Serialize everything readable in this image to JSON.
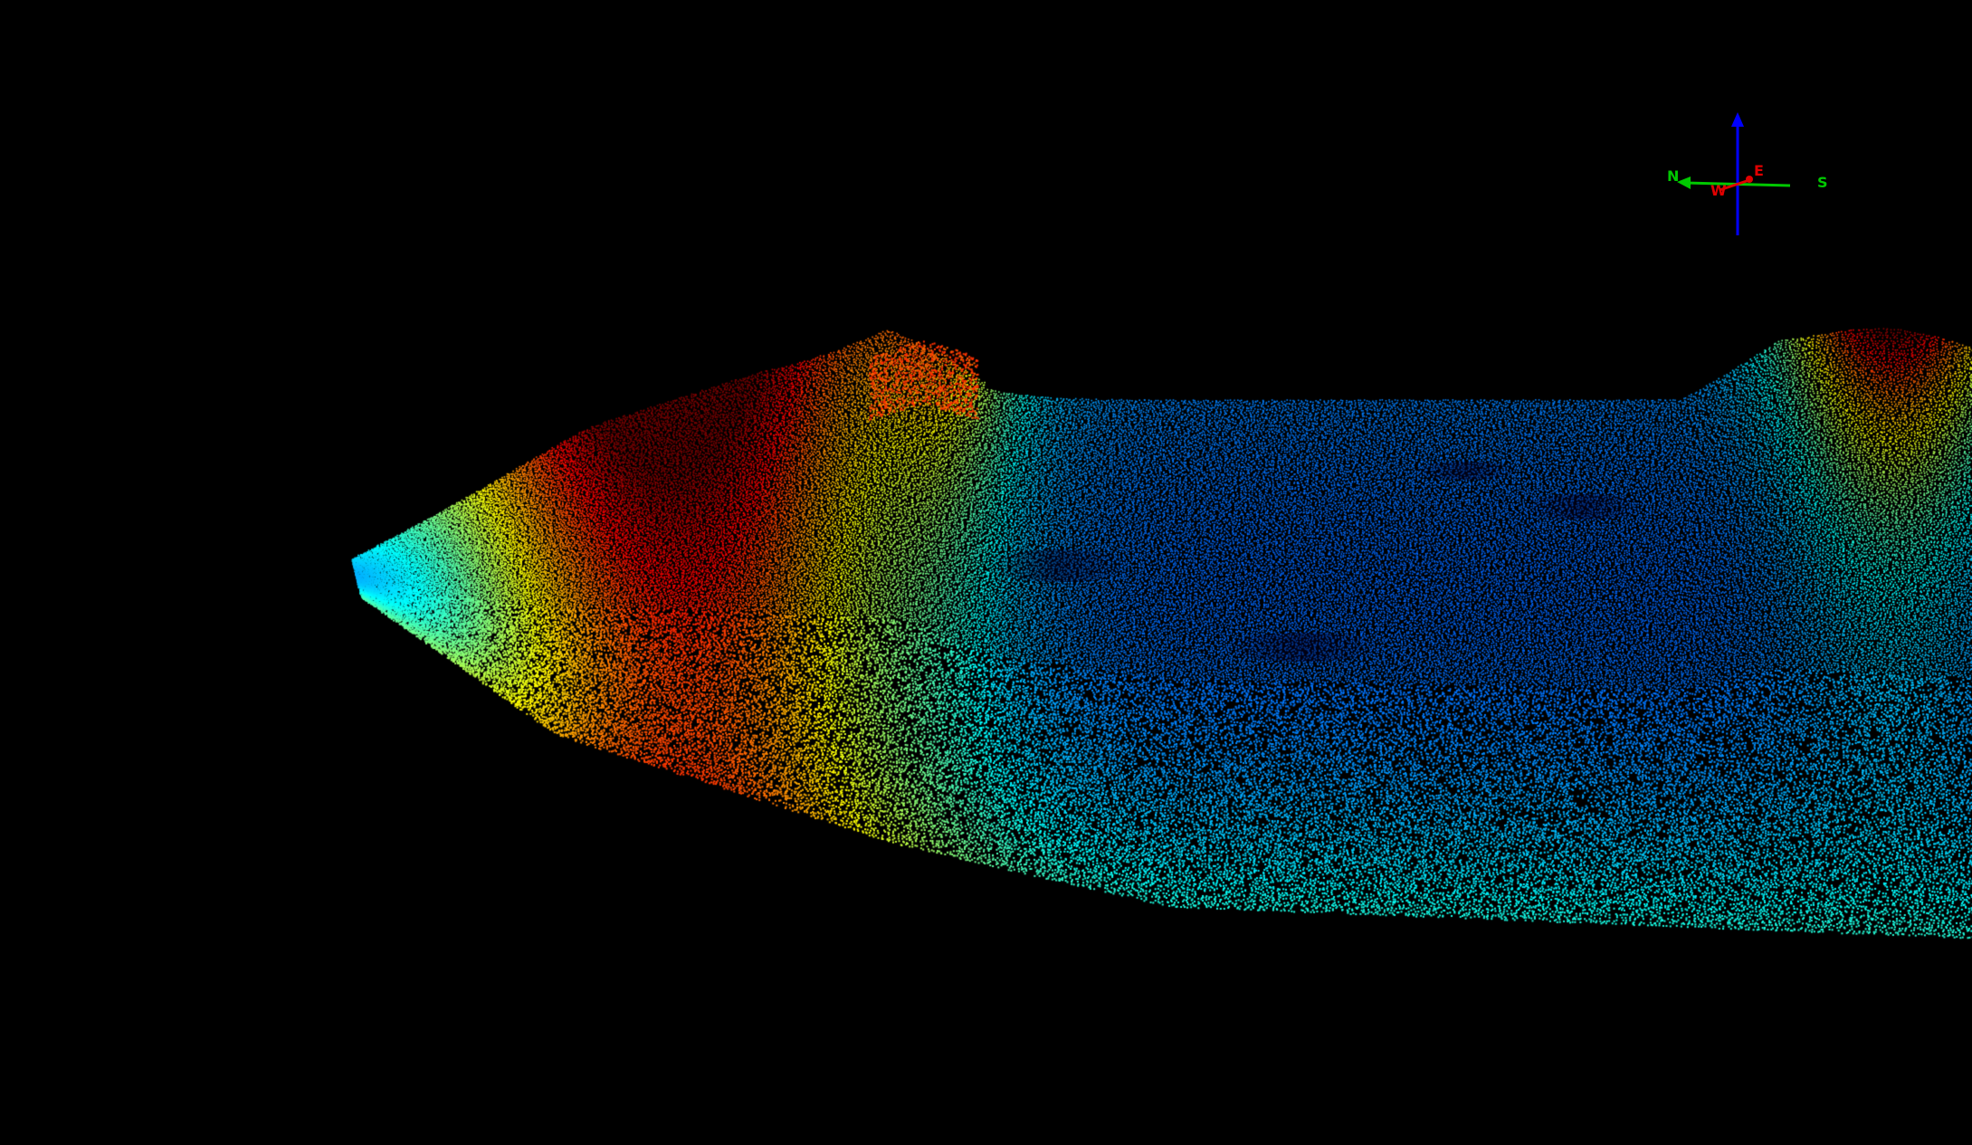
{
  "scene": {
    "type": "bathymetry-point-cloud",
    "background_color": "#000000",
    "colormap": [
      "#ff0000",
      "#ff8000",
      "#ffff00",
      "#00ff00",
      "#00ffff",
      "#0080ff",
      "#0000ff"
    ]
  },
  "orientation_gizmo": {
    "labels": {
      "north": "N",
      "south": "S",
      "east": "E",
      "west": "W"
    },
    "colors": {
      "vertical_axis": "#0000ff",
      "north_south_axis": "#00c800",
      "east_west_axis": "#e00000"
    }
  }
}
